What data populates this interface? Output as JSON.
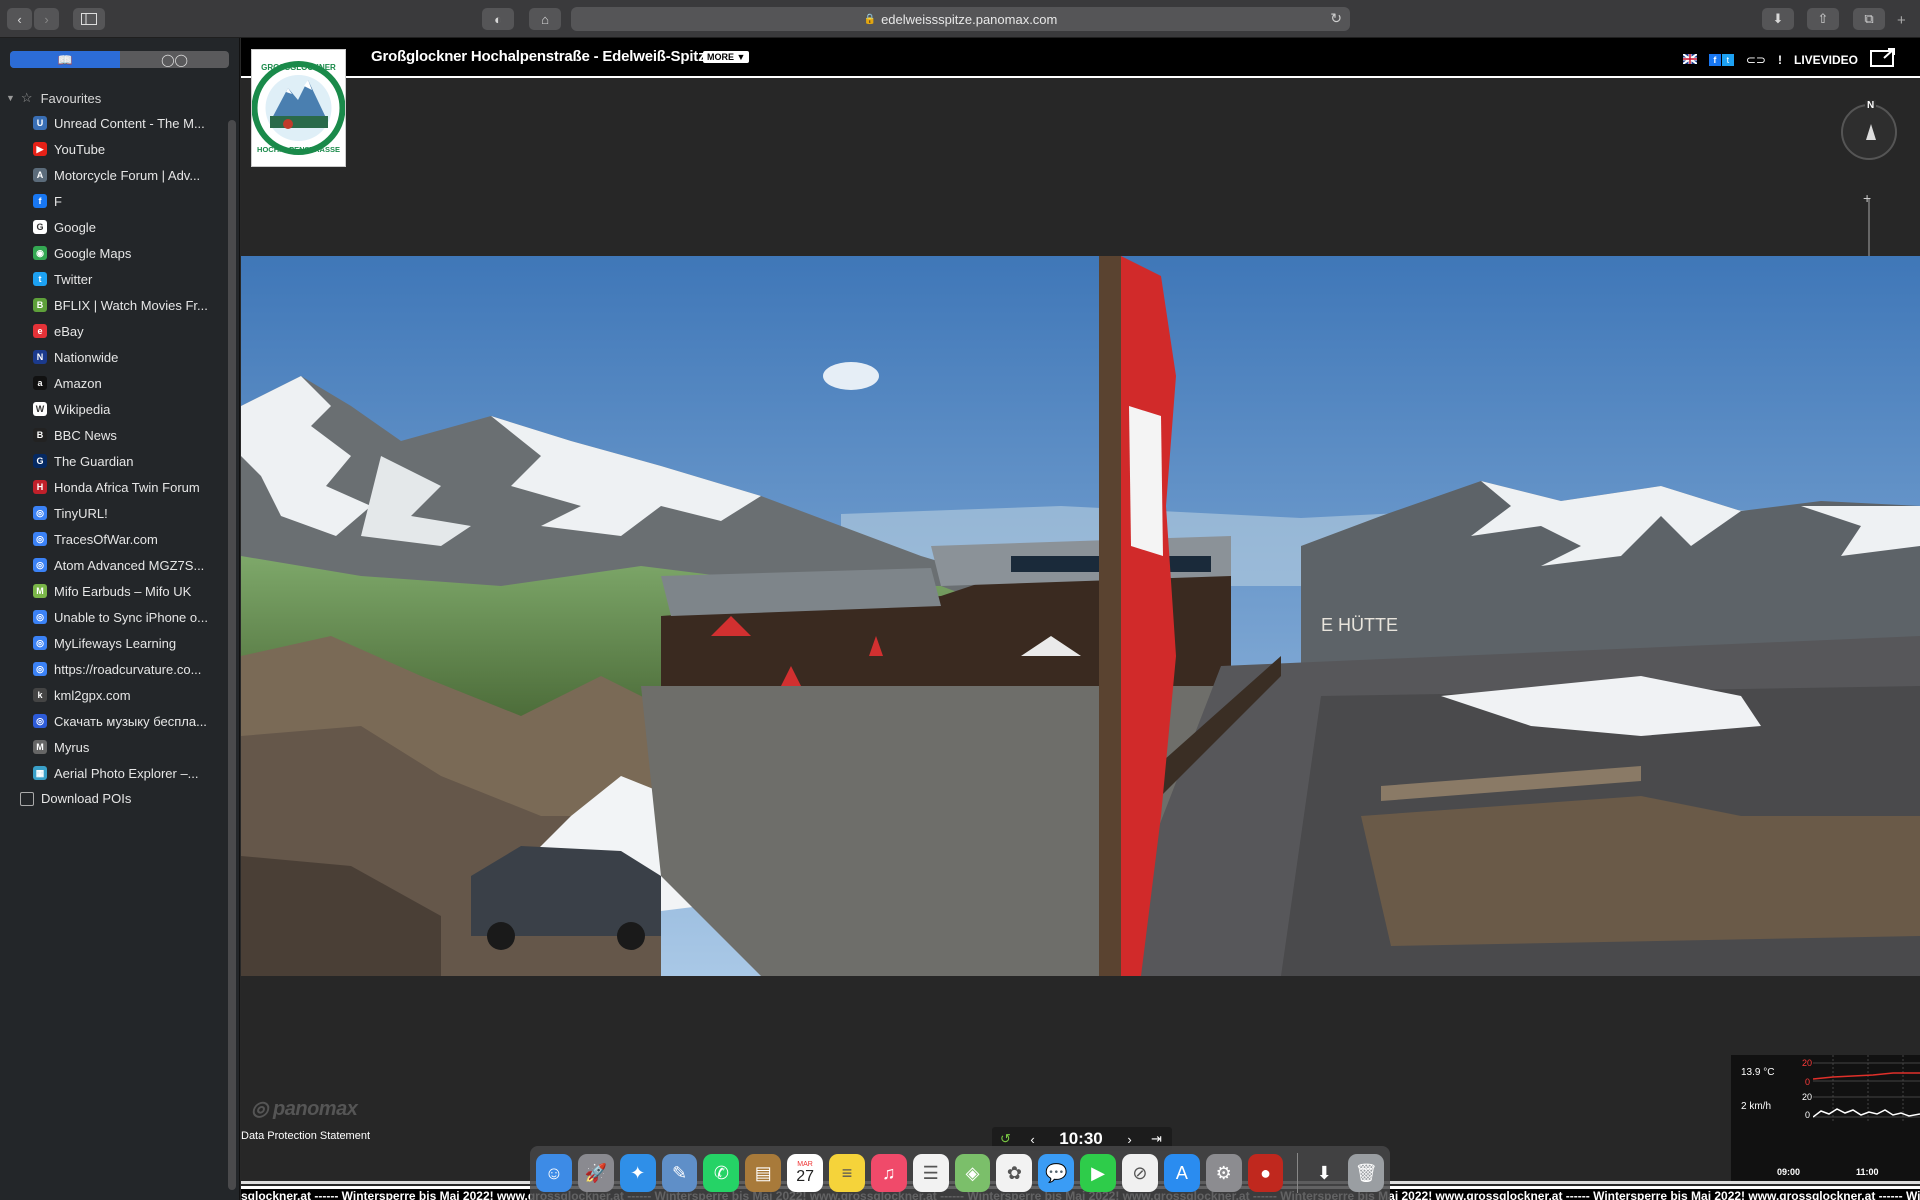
{
  "browser": {
    "url": "edelweissspitze.panomax.com"
  },
  "sidebar": {
    "favourites_label": "Favourites",
    "items": [
      {
        "label": "Unread Content - The M...",
        "color": "#3a6fb5",
        "glyph": "U"
      },
      {
        "label": "YouTube",
        "color": "#e62117",
        "glyph": "▶"
      },
      {
        "label": "Motorcycle Forum | Adv...",
        "color": "#5b6b7a",
        "glyph": "A"
      },
      {
        "label": "F",
        "color": "#1877f2",
        "glyph": "f"
      },
      {
        "label": "Google",
        "color": "#ffffff",
        "glyph": "G"
      },
      {
        "label": "Google Maps",
        "color": "#34a853",
        "glyph": "◉"
      },
      {
        "label": "Twitter",
        "color": "#1da1f2",
        "glyph": "t"
      },
      {
        "label": "BFLIX | Watch Movies Fr...",
        "color": "#5ea03a",
        "glyph": "B"
      },
      {
        "label": "eBay",
        "color": "#e53238",
        "glyph": "e"
      },
      {
        "label": "Nationwide",
        "color": "#1b3a8c",
        "glyph": "N"
      },
      {
        "label": "Amazon",
        "color": "#111111",
        "glyph": "a"
      },
      {
        "label": "Wikipedia",
        "color": "#ffffff",
        "glyph": "W"
      },
      {
        "label": "BBC News",
        "color": "#222222",
        "glyph": "B"
      },
      {
        "label": "The Guardian",
        "color": "#052962",
        "glyph": "G"
      },
      {
        "label": "Honda Africa Twin Forum",
        "color": "#c0202a",
        "glyph": "H"
      },
      {
        "label": "TinyURL!",
        "color": "#3b82f6",
        "glyph": "◎"
      },
      {
        "label": "TracesOfWar.com",
        "color": "#3b82f6",
        "glyph": "◎"
      },
      {
        "label": "Atom Advanced MGZ7S...",
        "color": "#3b82f6",
        "glyph": "◎"
      },
      {
        "label": "Mifo Earbuds – Mifo UK",
        "color": "#7ab648",
        "glyph": "M"
      },
      {
        "label": "Unable to Sync iPhone o...",
        "color": "#3b82f6",
        "glyph": "◎"
      },
      {
        "label": "MyLifeways Learning",
        "color": "#3b82f6",
        "glyph": "◎"
      },
      {
        "label": "https://roadcurvature.co...",
        "color": "#3b82f6",
        "glyph": "◎"
      },
      {
        "label": "kml2gpx.com",
        "color": "#444444",
        "glyph": "k"
      },
      {
        "label": "Скачать музыку бесплa...",
        "color": "#2d5bd8",
        "glyph": "◎"
      },
      {
        "label": "Myrus",
        "color": "#666666",
        "glyph": "M"
      },
      {
        "label": "Aerial Photo Explorer –...",
        "color": "#3aa0c8",
        "glyph": "▦"
      }
    ],
    "download_label": "Download POIs"
  },
  "page": {
    "title": "Großglockner Hochalpenstraße - Edelweiß-Spitze",
    "more_label": "MORE",
    "livevideo_label": "LIVEVIDEO",
    "compass_label": "N",
    "data_protection": "Data Protection Statement",
    "panomax_brand": "panomax",
    "time": "10:30",
    "weather": {
      "temperature": "13.9 °C",
      "wind": "2 km/h",
      "temp_axis_top": "20",
      "temp_axis_bottom": "0",
      "wind_axis_top": "20",
      "wind_axis_bottom": "0",
      "time_start": "09:00",
      "time_end": "11:00"
    },
    "ticker": "sglockner.at ------ Wintersperre bis Mai 2022!  www.grossglockner.at ------ Wintersperre bis Mai 2022!  www.grossglockner.at ------ Wintersperre bis Mai 2022!  www.grossglockner.at ------ Wintersperre bis Mai 2022!  www.grossglockner.at ------ Wintersperre bis Mai 2022!  www.grossglockner.at ------ Wintersperre bis Mai 2022!  www.grossglockner.at ------ Wintersperre bis M",
    "hut_sign": "E  HÜTTE"
  },
  "dock": {
    "calendar_month": "MAR",
    "calendar_day": "27",
    "apps": [
      {
        "name": "finder",
        "color": "#3d8be6",
        "glyph": "☺"
      },
      {
        "name": "launchpad",
        "color": "#8a8a90",
        "glyph": "🚀"
      },
      {
        "name": "safari",
        "color": "#2f8fe8",
        "glyph": "✦"
      },
      {
        "name": "preview",
        "color": "#5f8fc8",
        "glyph": "✎"
      },
      {
        "name": "whatsapp",
        "color": "#25d366",
        "glyph": "✆"
      },
      {
        "name": "notebook",
        "color": "#a87a3a",
        "glyph": "▤"
      },
      {
        "name": "calendar",
        "color": "#ffffff",
        "glyph": ""
      },
      {
        "name": "notes",
        "color": "#f5d33a",
        "glyph": "≡"
      },
      {
        "name": "itunes",
        "color": "#f04a6a",
        "glyph": "♫"
      },
      {
        "name": "reminders",
        "color": "#f2f2f2",
        "glyph": "☰"
      },
      {
        "name": "maps",
        "color": "#7bbf6a",
        "glyph": "◈"
      },
      {
        "name": "photos",
        "color": "#f2f2f2",
        "glyph": "✿"
      },
      {
        "name": "messages",
        "color": "#3a9cf5",
        "glyph": "💬"
      },
      {
        "name": "facetime",
        "color": "#2ecc4a",
        "glyph": "▶"
      },
      {
        "name": "news",
        "color": "#f0f0f0",
        "glyph": "⊘"
      },
      {
        "name": "app-store",
        "color": "#2a8cf0",
        "glyph": "A"
      },
      {
        "name": "system-preferences",
        "color": "#8c8c90",
        "glyph": "⚙"
      },
      {
        "name": "boxing-gloves",
        "color": "#c0281e",
        "glyph": "●"
      }
    ]
  }
}
